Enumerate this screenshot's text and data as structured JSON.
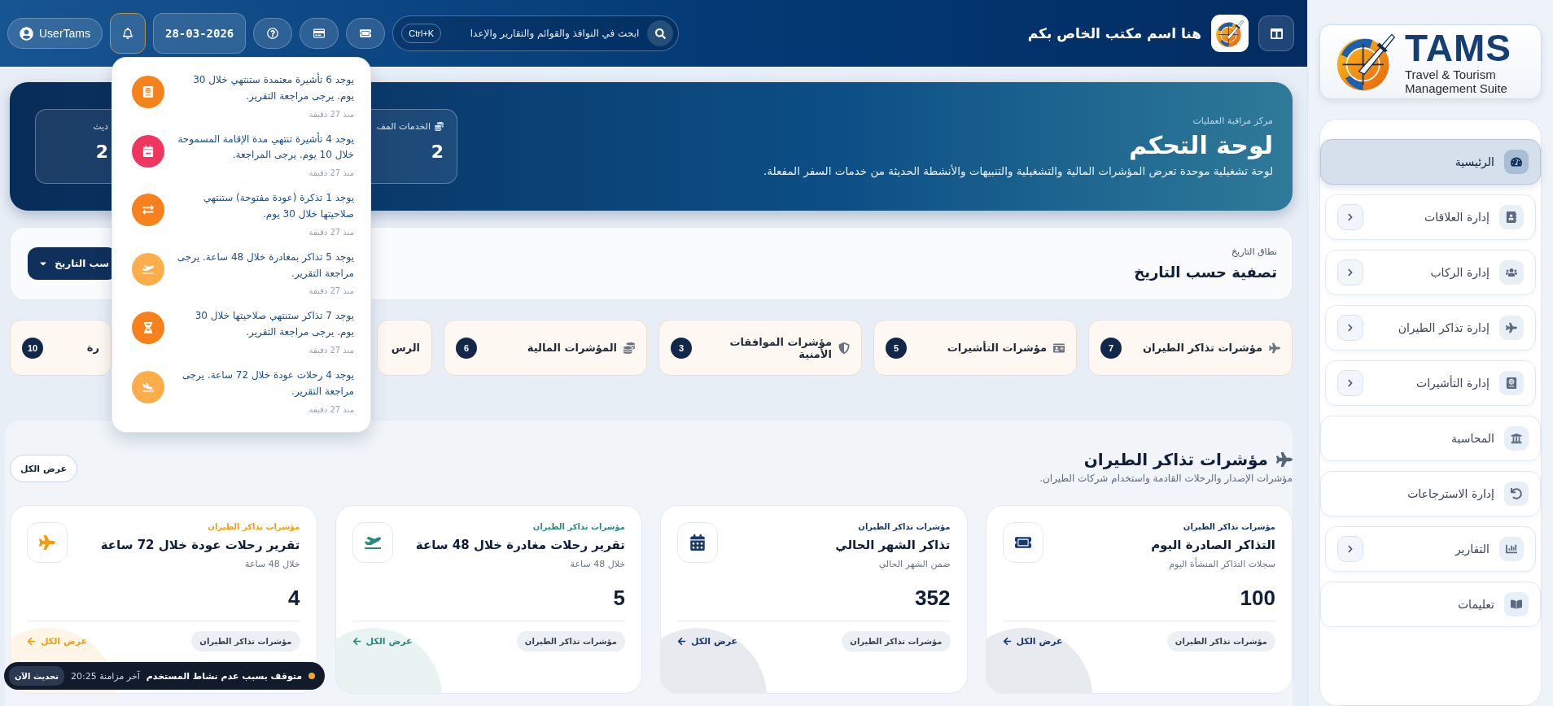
{
  "brand": {
    "name": "TAMS",
    "line1": "Travel & Tourism",
    "line2": "Management Suite"
  },
  "sidebar": {
    "items": [
      {
        "label": "الرئيسية",
        "selected": true,
        "has_submenu": false
      },
      {
        "label": "إدارة العلاقات",
        "selected": false,
        "has_submenu": true
      },
      {
        "label": "إدارة الركاب",
        "selected": false,
        "has_submenu": true
      },
      {
        "label": "إدارة تذاكر الطيران",
        "selected": false,
        "has_submenu": true
      },
      {
        "label": "إدارة التأشيرات",
        "selected": false,
        "has_submenu": true
      },
      {
        "label": "المحاسبة",
        "selected": false,
        "has_submenu": false
      },
      {
        "label": "إدارة الاسترجاعات",
        "selected": false,
        "has_submenu": false
      },
      {
        "label": "التقارير",
        "selected": false,
        "has_submenu": true
      },
      {
        "label": "تعليمات",
        "selected": false,
        "has_submenu": false
      }
    ]
  },
  "topbar": {
    "office_name": "هنا اسم مكتب الخاص بكم",
    "user": "UserTams",
    "date": "28-03-2026",
    "notifications_open": true,
    "search": {
      "placeholder": "ابحث في النوافذ والقوائم والتقارير والإعدا",
      "shortcut": "Ctrl+K"
    }
  },
  "notifications": [
    {
      "text": "يوجد 6 تأشيرة معتمدة ستنتهي خلال 30 يوم. يرجى مراجعة التقرير.",
      "time": "منذ 27 دقيقة",
      "color": "#f7821b"
    },
    {
      "text": "يوجد 4 تأشيرة تنتهي مدة الإقامة المسموحة خلال 10 يوم. يرجى المراجعة.",
      "time": "منذ 27 دقيقة",
      "color": "#f0365e"
    },
    {
      "text": "يوجد 1 تذكرة (عودة مفتوحة) ستنتهي صلاحيتها خلال 30 يوم.",
      "time": "منذ 27 دقيقة",
      "color": "#f7821b"
    },
    {
      "text": "يوجد 5 تذاكر بمغادرة خلال 48 ساعة. يرجى مراجعة التقرير.",
      "time": "منذ 27 دقيقة",
      "color": "#fdad4a"
    },
    {
      "text": "يوجد 7 تذاكر ستنتهي صلاحيتها خلال 30 يوم. يرجى مراجعة التقرير.",
      "time": "منذ 27 دقيقة",
      "color": "#f7821b"
    },
    {
      "text": "يوجد 4 رحلات عودة خلال 72 ساعة. يرجى مراجعة التقرير.",
      "time": "منذ 27 دقيقة",
      "color": "#fdad4a"
    }
  ],
  "hero": {
    "eyebrow": "مركز مراقبة العمليات",
    "title": "لوحة التحكم",
    "description": "لوحة تشغيلية موحدة تعرض المؤشرات المالية والتشغيلية والتنبيهات والأنشطة الحديثة من خدمات السفر المفعلة.",
    "stats": [
      {
        "label": "الخدمات المف",
        "value": "2"
      },
      {
        "label": "ديث",
        "value": "2"
      }
    ]
  },
  "filter": {
    "label": "نطاق التاريخ",
    "title": "تصفية حسب التاريخ",
    "button": "سب التاريخ"
  },
  "indicator_tabs": [
    {
      "label": "مؤشرات تذاكر الطيران",
      "count": "7"
    },
    {
      "label": "مؤشرات التأشيرات",
      "count": "5"
    },
    {
      "label": "مؤشرات الموافقات الأمنية",
      "count": "3"
    },
    {
      "label": "المؤشرات المالية",
      "count": "6"
    },
    {
      "label": "الرس"
    },
    {
      "label": "رة",
      "count": "10"
    }
  ],
  "section": {
    "title": "مؤشرات تذاكر الطيران",
    "subtitle": "مؤشرات الإصدار والرحلات القادمة واستخدام شركات الطيران.",
    "view_all": "عرض الكل",
    "cards": [
      {
        "tag": "مؤشرات تذاكر الطيران",
        "title": "التذاكر الصادرة اليوم",
        "subtitle": "سجلات التذاكر المنشأة اليوم",
        "value": "100",
        "pill": "مؤشرات تذاكر الطيران",
        "link": "عرض الكل",
        "color": "#17386a"
      },
      {
        "tag": "مؤشرات تذاكر الطيران",
        "title": "تذاكر الشهر الحالي",
        "subtitle": "ضمن الشهر الحالي",
        "value": "352",
        "pill": "مؤشرات تذاكر الطيران",
        "link": "عرض الكل",
        "color": "#17386a"
      },
      {
        "tag": "مؤشرات تذاكر الطيران",
        "title": "تقرير رحلات مغادرة خلال 48 ساعة",
        "subtitle": "خلال 48 ساعة",
        "value": "5",
        "pill": "مؤشرات تذاكر الطيران",
        "link": "عرض الكل",
        "color": "#2a8a80"
      },
      {
        "tag": "مؤشرات تذاكر الطيران",
        "title": "تقرير رحلات عودة خلال 72 ساعة",
        "subtitle": "خلال 48 ساعة",
        "value": "4",
        "pill": "مؤشرات تذاكر الطيران",
        "link": "عرض الكل",
        "color": "#f39c12"
      }
    ]
  },
  "sync": {
    "paused": true,
    "status": "متوقف بسبب عدم نشاط المستخدم",
    "last_sync": "آخر مزامنة 20:25",
    "button": "تحديث الآن"
  }
}
